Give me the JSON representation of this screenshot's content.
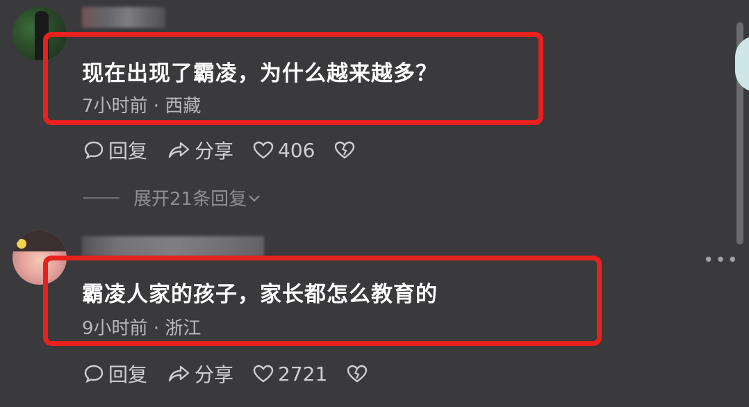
{
  "comments": [
    {
      "text": "现在出现了霸凌，为什么越来越多？",
      "meta": "7小时前 · 西藏",
      "reply_label": "回复",
      "share_label": "分享",
      "likes": "406"
    },
    {
      "text": "霸凌人家的孩子，家长都怎么教育的",
      "meta": "9小时前 · 浙江",
      "reply_label": "回复",
      "share_label": "分享",
      "likes": "2721"
    }
  ],
  "expand_replies": "展开21条回复",
  "colors": {
    "highlight": "#e8201e",
    "background": "#3a3a3c"
  }
}
